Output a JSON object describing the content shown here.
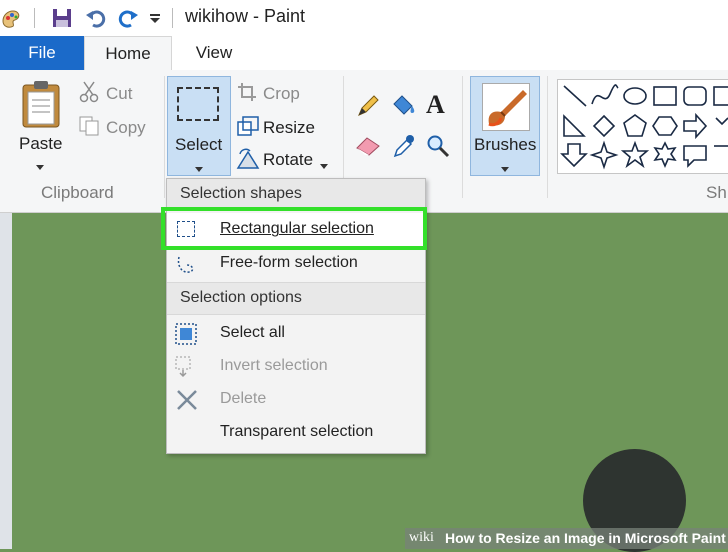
{
  "window": {
    "title": "wikihow - Paint"
  },
  "tabs": {
    "file": "File",
    "home": "Home",
    "view": "View"
  },
  "clipboard": {
    "paste": "Paste",
    "cut": "Cut",
    "copy": "Copy",
    "group": "Clipboard"
  },
  "image": {
    "select": "Select",
    "crop": "Crop",
    "resize": "Resize",
    "rotate": "Rotate"
  },
  "brushes": {
    "label": "Brushes"
  },
  "shapes": {
    "group_partial": "Sh"
  },
  "menu": {
    "header_shapes": "Selection shapes",
    "rectangular": "Rectangular selection",
    "freeform": "Free-form selection",
    "header_options": "Selection options",
    "select_all": "Select all",
    "invert": "Invert selection",
    "delete": "Delete",
    "transparent": "Transparent selection"
  },
  "watermark": {
    "brand": "wiki",
    "text": "How to Resize an Image in Microsoft Paint"
  },
  "colors": {
    "file_tab": "#1b6ac9",
    "canvas": "#6e9659",
    "highlight": "#33e02a"
  }
}
